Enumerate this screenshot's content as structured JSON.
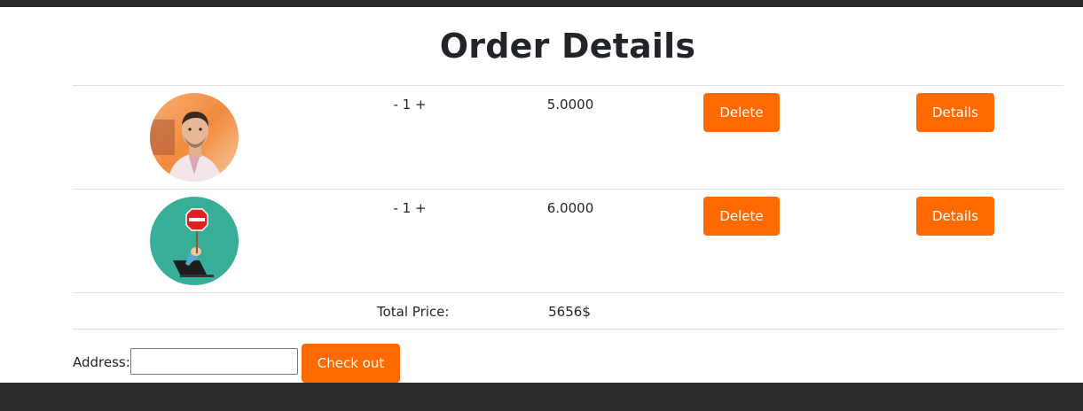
{
  "page": {
    "title": "Order Details"
  },
  "colors": {
    "accent": "#ff6a00",
    "header_bar": "#2b2b2b",
    "footer_bar": "#2e2e2e"
  },
  "order_items": [
    {
      "image_icon": "person-photo-avatar",
      "quantity_control": "- 1 +",
      "price": "5.0000",
      "delete_label": "Delete",
      "details_label": "Details"
    },
    {
      "image_icon": "error-sign-laptop-avatar",
      "quantity_control": "- 1 +",
      "price": "6.0000",
      "delete_label": "Delete",
      "details_label": "Details"
    }
  ],
  "total": {
    "label": "Total Price:",
    "value": "5656$"
  },
  "checkout": {
    "address_label": "Address:",
    "address_value": "",
    "address_placeholder": "",
    "button_label": "Check out"
  }
}
